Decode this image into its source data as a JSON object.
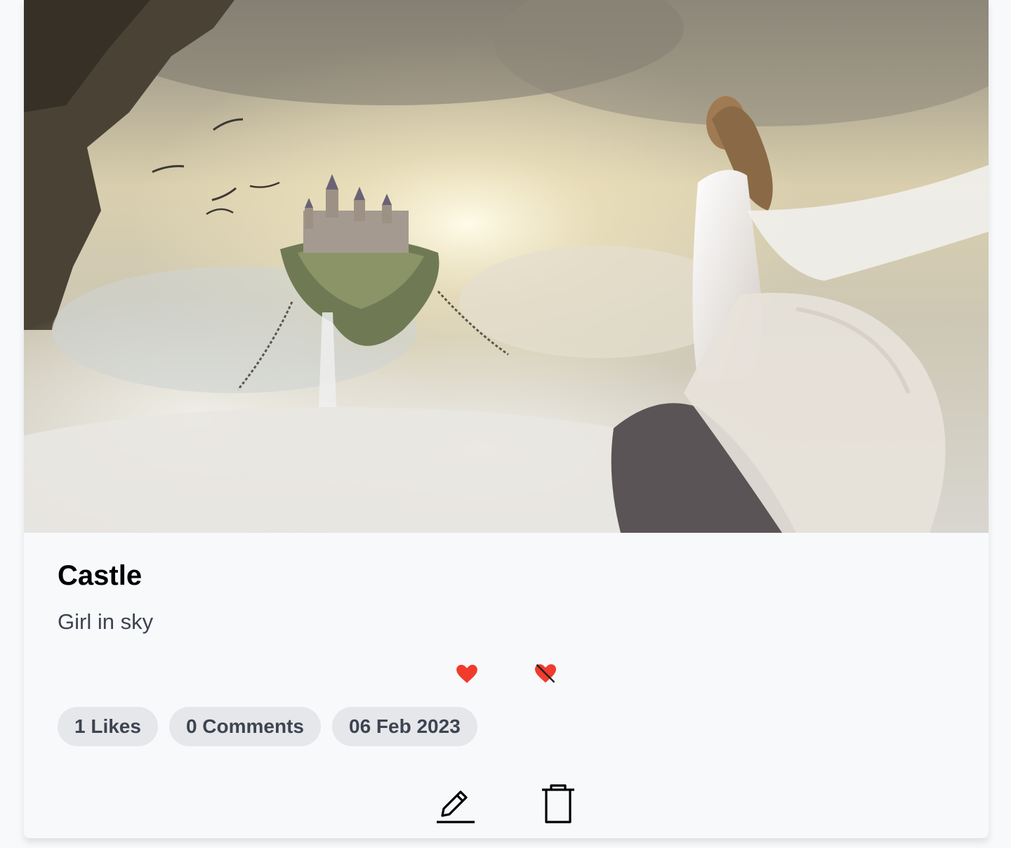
{
  "post": {
    "title": "Castle",
    "description": "Girl in sky",
    "image_alt": "Girl in sky"
  },
  "reactions": {
    "like_icon": "heart-icon",
    "dislike_icon": "heart-crossed-icon",
    "like_color": "#f03b2d"
  },
  "stats": {
    "likes": "1 Likes",
    "comments": "0 Comments",
    "date": "06 Feb 2023"
  },
  "actions": {
    "edit_icon": "pencil-icon",
    "delete_icon": "trash-icon"
  }
}
